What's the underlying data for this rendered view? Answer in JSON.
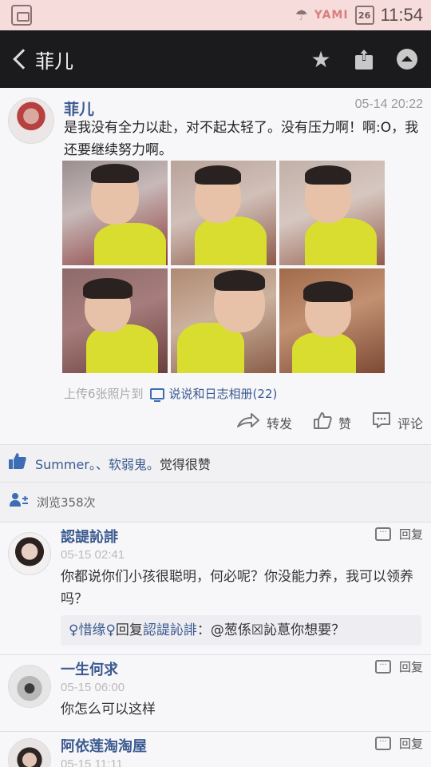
{
  "status_bar": {
    "time": "11:54",
    "calendar_day": "26",
    "carrier_logo": "YAMI",
    "icons": [
      "sim-icon",
      "cloud-umbrella-icon",
      "calendar-icon"
    ]
  },
  "nav": {
    "title": "菲儿",
    "actions": [
      "star-icon",
      "share-icon",
      "more-icon"
    ]
  },
  "post": {
    "author": "菲儿",
    "time": "05-14 20:22",
    "text": "是我没有全力以赴，对不起太轻了。没有压力啊！啊:O，我还要继续努力啊。",
    "photo_count": 6,
    "upload_prefix": "上传6张照片到",
    "album_name": "说说和日志相册(22)",
    "actions": {
      "forward": "转发",
      "like": "赞",
      "comment": "评论"
    }
  },
  "likes": {
    "names": "Summer。、软弱鬼。",
    "suffix": "觉得很赞"
  },
  "views": {
    "text": "浏览358次"
  },
  "comments": [
    {
      "name": "認諟訫誹",
      "time": "05-15 02:41",
      "text": "你都说你们小孩很聪明，何必呢？你没能力养，我可以领养吗？",
      "reply_label": "回复",
      "sub_reply": {
        "who": "♀惜缘♀",
        "mid": "回复",
        "target": "認諟訫誹",
        "content": "：@葱係☒訫蒠你想要？"
      }
    },
    {
      "name": "一生何求",
      "time": "05-15 06:00",
      "text": "你怎么可以这样",
      "reply_label": "回复"
    },
    {
      "name": "阿依莲淘淘屋",
      "time": "05-15 11:11",
      "text": "",
      "reply_label": "回复"
    }
  ],
  "colors": {
    "nav_bg": "#1b1b1d",
    "status_bg": "#f7dcdc",
    "link": "#3b5a8f",
    "accent": "#3d6db4"
  }
}
